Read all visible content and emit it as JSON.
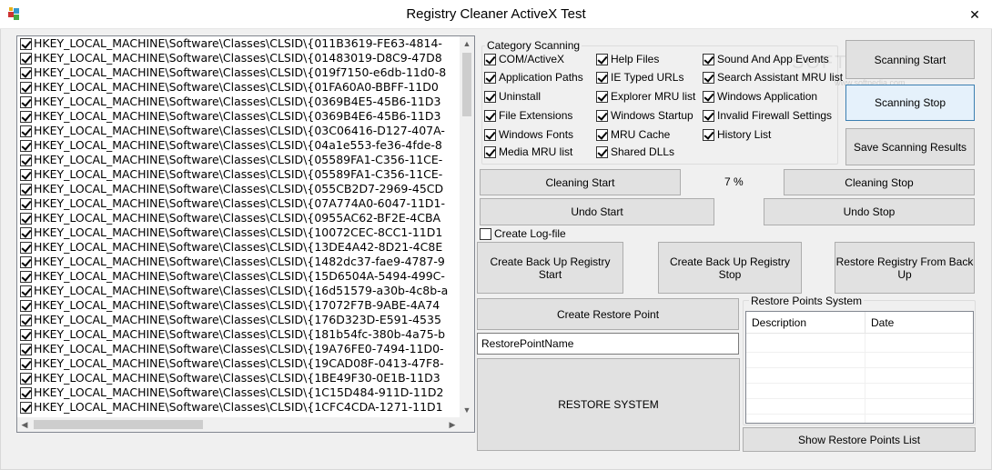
{
  "window": {
    "title": "Registry Cleaner ActiveX Test",
    "close_glyph": "✕"
  },
  "registry_list": {
    "items": [
      "HKEY_LOCAL_MACHINE\\Software\\Classes\\CLSID\\{011B3619-FE63-4814-",
      "HKEY_LOCAL_MACHINE\\Software\\Classes\\CLSID\\{01483019-D8C9-47D8",
      "HKEY_LOCAL_MACHINE\\Software\\Classes\\CLSID\\{019f7150-e6db-11d0-8",
      "HKEY_LOCAL_MACHINE\\Software\\Classes\\CLSID\\{01FA60A0-BBFF-11D0",
      "HKEY_LOCAL_MACHINE\\Software\\Classes\\CLSID\\{0369B4E5-45B6-11D3",
      "HKEY_LOCAL_MACHINE\\Software\\Classes\\CLSID\\{0369B4E6-45B6-11D3",
      "HKEY_LOCAL_MACHINE\\Software\\Classes\\CLSID\\{03C06416-D127-407A-",
      "HKEY_LOCAL_MACHINE\\Software\\Classes\\CLSID\\{04a1e553-fe36-4fde-8",
      "HKEY_LOCAL_MACHINE\\Software\\Classes\\CLSID\\{05589FA1-C356-11CE-",
      "HKEY_LOCAL_MACHINE\\Software\\Classes\\CLSID\\{05589FA1-C356-11CE-",
      "HKEY_LOCAL_MACHINE\\Software\\Classes\\CLSID\\{055CB2D7-2969-45CD",
      "HKEY_LOCAL_MACHINE\\Software\\Classes\\CLSID\\{07A774A0-6047-11D1-",
      "HKEY_LOCAL_MACHINE\\Software\\Classes\\CLSID\\{0955AC62-BF2E-4CBA",
      "HKEY_LOCAL_MACHINE\\Software\\Classes\\CLSID\\{10072CEC-8CC1-11D1",
      "HKEY_LOCAL_MACHINE\\Software\\Classes\\CLSID\\{13DE4A42-8D21-4C8E",
      "HKEY_LOCAL_MACHINE\\Software\\Classes\\CLSID\\{1482dc37-fae9-4787-9",
      "HKEY_LOCAL_MACHINE\\Software\\Classes\\CLSID\\{15D6504A-5494-499C-",
      "HKEY_LOCAL_MACHINE\\Software\\Classes\\CLSID\\{16d51579-a30b-4c8b-a",
      "HKEY_LOCAL_MACHINE\\Software\\Classes\\CLSID\\{17072F7B-9ABE-4A74",
      "HKEY_LOCAL_MACHINE\\Software\\Classes\\CLSID\\{176D323D-E591-4535",
      "HKEY_LOCAL_MACHINE\\Software\\Classes\\CLSID\\{181b54fc-380b-4a75-b",
      "HKEY_LOCAL_MACHINE\\Software\\Classes\\CLSID\\{19A76FE0-7494-11D0-",
      "HKEY_LOCAL_MACHINE\\Software\\Classes\\CLSID\\{19CAD08F-0413-47F8-",
      "HKEY_LOCAL_MACHINE\\Software\\Classes\\CLSID\\{1BE49F30-0E1B-11D3",
      "HKEY_LOCAL_MACHINE\\Software\\Classes\\CLSID\\{1C15D484-911D-11D2",
      "HKEY_LOCAL_MACHINE\\Software\\Classes\\CLSID\\{1CFC4CDA-1271-11D1"
    ]
  },
  "category_scanning": {
    "label": "Category Scanning",
    "col1": [
      "COM/ActiveX",
      "Application Paths",
      "Uninstall",
      "File Extensions",
      "Windows Fonts",
      "Media MRU list"
    ],
    "col2": [
      "Help Files",
      "IE Typed URLs",
      "Explorer MRU list",
      "Windows Startup",
      "MRU Cache",
      "Shared DLLs"
    ],
    "col3": [
      "Sound And App Events",
      "Search Assistant MRU list",
      "Windows Application",
      "Invalid Firewall Settings",
      "History List"
    ]
  },
  "buttons": {
    "scanning_start": "Scanning Start",
    "scanning_stop": "Scanning Stop",
    "save_scanning_results": "Save Scanning Results",
    "cleaning_start": "Cleaning Start",
    "cleaning_stop": "Cleaning Stop",
    "undo_start": "Undo Start",
    "undo_stop": "Undo Stop",
    "backup_start": "Create Back Up Registry Start",
    "backup_stop": "Create Back Up Registry Stop",
    "restore_from_backup": "Restore Registry From Back Up",
    "create_restore_point": "Create Restore Point",
    "restore_system": "RESTORE SYSTEM",
    "show_restore_points": "Show Restore Points List"
  },
  "progress": {
    "percent_text": "7 %"
  },
  "create_log_file": {
    "label": "Create Log-file",
    "checked": false
  },
  "restore_point_name": {
    "value": "RestorePointName"
  },
  "restore_points_system": {
    "label": "Restore Points System",
    "columns": [
      "Description",
      "Date"
    ]
  },
  "watermark": {
    "text": "SOFTPEDIA",
    "sub": "www.softpedia.com"
  }
}
